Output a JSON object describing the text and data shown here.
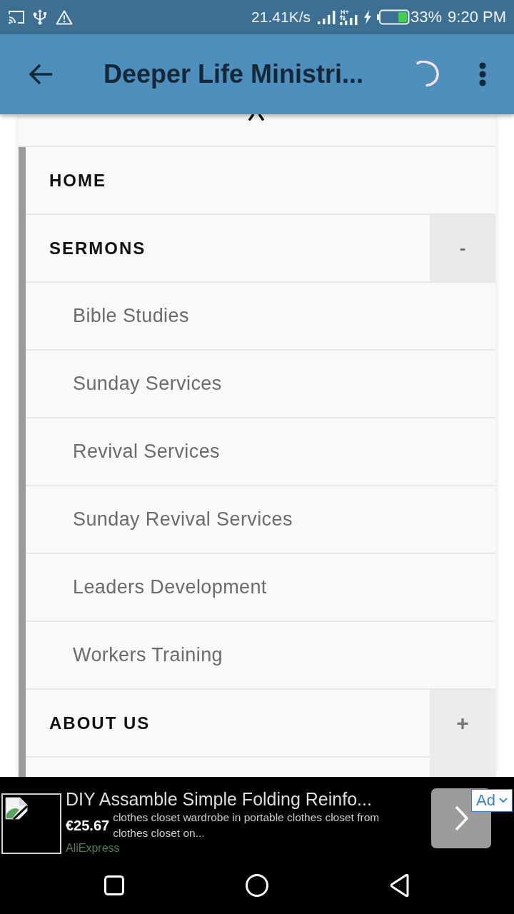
{
  "status_bar": {
    "network_speed": "21.41K/s",
    "network_type": "H+",
    "charging": true,
    "battery": "33%",
    "time": "9:20 PM"
  },
  "app_bar": {
    "title": "Deeper Life Ministri...",
    "loading": true
  },
  "menu": {
    "items": [
      {
        "label": "HOME"
      },
      {
        "label": "SERMONS",
        "toggle": "-",
        "expanded": true,
        "children": [
          {
            "label": "Bible Studies"
          },
          {
            "label": "Sunday Services"
          },
          {
            "label": "Revival Services"
          },
          {
            "label": "Sunday Revival Services"
          },
          {
            "label": "Leaders Development"
          },
          {
            "label": "Workers Training"
          }
        ]
      },
      {
        "label": "ABOUT US",
        "toggle": "+",
        "expanded": false
      }
    ]
  },
  "ad": {
    "title": "DIY Assamble Simple Folding Reinfo...",
    "price": "€25.67",
    "description": "clothes closet wardrobe in portable clothes closet from clothes closet on...",
    "advertiser": "AliExpress",
    "badge": "Ad"
  }
}
